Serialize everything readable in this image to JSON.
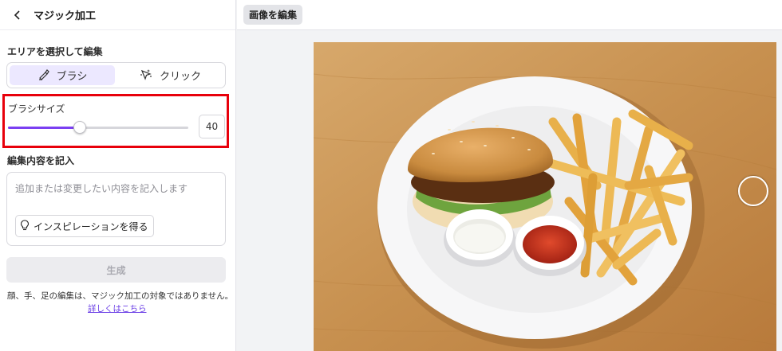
{
  "panel": {
    "title": "マジック加工",
    "area_section_label": "エリアを選択して編集",
    "modes": [
      {
        "label": "ブラシ",
        "icon": "brush-icon",
        "active": true
      },
      {
        "label": "クリック",
        "icon": "magic-click-icon",
        "active": false
      }
    ],
    "brush_size": {
      "label": "ブラシサイズ",
      "value": "40",
      "fraction": 0.4
    },
    "prompt_section_label": "編集内容を記入",
    "prompt_placeholder": "追加または変更したい内容を記入します",
    "inspiration_button": "インスピレーションを得る",
    "generate_button": "生成",
    "notice": "顔、手、足の編集は、マジック加工の対象ではありません。",
    "learn_more": "詳しくはこちら"
  },
  "topbar": {
    "edit_tab": "画像を編集"
  },
  "colors": {
    "accent": "#7b3ff2",
    "highlight_box": "#e8000b",
    "active_tab_bg": "#ece8ff"
  }
}
